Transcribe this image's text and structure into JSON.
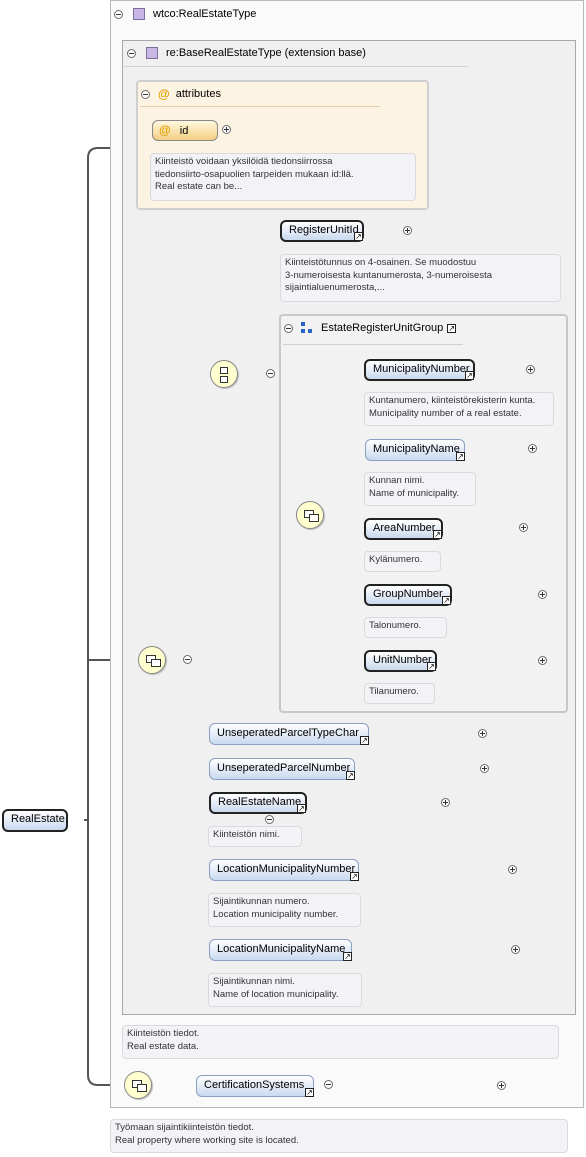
{
  "root": {
    "name": "RealEstate",
    "type": "wtco:RealEstateType"
  },
  "extension_base": "re:BaseRealEstateType (extension base)",
  "attributes": {
    "title": "attributes",
    "id": {
      "name": "id",
      "doc": [
        "Kiinteistö voidaan yksilöidä tiedonsiirrossa",
        "tiedonsiirto-osapuolien tarpeiden mukaan id:llä.",
        "Real estate can be..."
      ]
    }
  },
  "register_unit_id": {
    "name": "RegisterUnitId",
    "doc": [
      "Kiinteistötunnus on 4-osainen. Se muodostuu",
      "3-numeroisesta kuntanumerosta, 3-numeroisesta",
      "sijaintialuenumerosta,..."
    ]
  },
  "group": {
    "name": "EstateRegisterUnitGroup",
    "elements": [
      {
        "name": "MunicipalityNumber",
        "doc": [
          "Kuntanumero, kiinteistörekisterin kunta.",
          "Municipality number of a real estate."
        ]
      },
      {
        "name": "MunicipalityName",
        "doc": [
          "Kunnan nimi.",
          "Name of municipality."
        ]
      },
      {
        "name": "AreaNumber",
        "doc": [
          "Kylänumero."
        ]
      },
      {
        "name": "GroupNumber",
        "doc": [
          "Talonumero."
        ]
      },
      {
        "name": "UnitNumber",
        "doc": [
          "Tilanumero."
        ]
      }
    ]
  },
  "choice_elements": [
    {
      "name": "UnseperatedParcelTypeChar",
      "doc": []
    },
    {
      "name": "UnseperatedParcelNumber",
      "doc": []
    },
    {
      "name": "RealEstateName",
      "doc": [
        "Kiinteistön nimi."
      ]
    },
    {
      "name": "LocationMunicipalityNumber",
      "doc": [
        "Sijaintikunnan numero.",
        "Location municipality number."
      ]
    },
    {
      "name": "LocationMunicipalityName",
      "doc": [
        "Sijaintikunnan nimi.",
        "Name of location municipality."
      ]
    }
  ],
  "base_doc": [
    "Kiinteistön tiedot.",
    "Real estate data."
  ],
  "certification": {
    "name": "CertificationSystems"
  },
  "root_doc": [
    "Työmaan sijaintikiinteistön tiedot.",
    "Real property where working site is located."
  ],
  "glyphs": {
    "ref": "↗"
  }
}
